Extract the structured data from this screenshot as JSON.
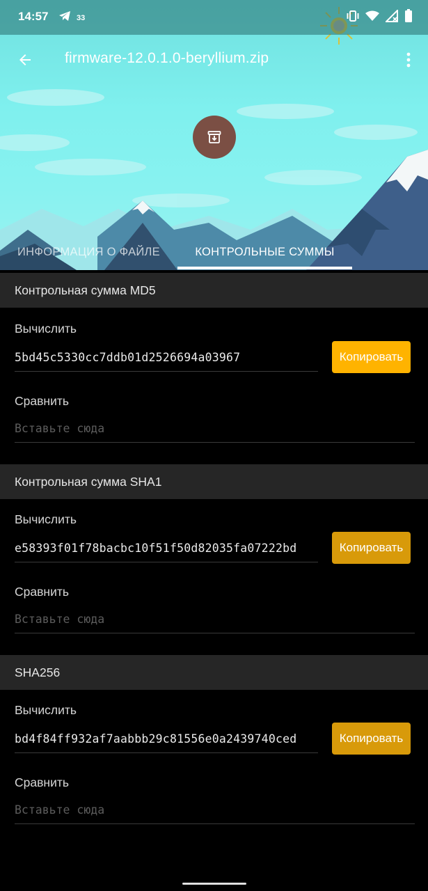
{
  "status": {
    "time": "14:57",
    "notif_count": "33",
    "icons": [
      "telegram-icon",
      "vibrate-icon",
      "wifi-icon",
      "signal-icon",
      "battery-icon"
    ]
  },
  "appbar": {
    "title": "firmware-12.0.1.0-beryllium.zip",
    "back_icon": "arrow-back-icon",
    "menu_icon": "more-vert-icon"
  },
  "file_icon": "archive-icon",
  "tabs": [
    {
      "label": "ИНФОРМАЦИЯ О ФАЙЛЕ",
      "selected": false
    },
    {
      "label": "КОНТРОЛЬНЫЕ СУММЫ",
      "selected": true
    }
  ],
  "colors": {
    "accent_button": "#ffb300",
    "accent_button_dim": "#d89a0a",
    "section_header_bg": "#262626",
    "avatar_bg": "#7b4f44"
  },
  "sections": [
    {
      "header": "Контрольная сумма MD5",
      "compute_label": "Вычислить",
      "hash": "5bd45c5330cc7ddb01d2526694a03967",
      "copy_label": "Копировать",
      "compare_label": "Сравнить",
      "compare_placeholder": "Вставьте сюда"
    },
    {
      "header": "Контрольная сумма SHA1",
      "compute_label": "Вычислить",
      "hash": "e58393f01f78bacbc10f51f50d82035fa07222bd",
      "copy_label": "Копировать",
      "compare_label": "Сравнить",
      "compare_placeholder": "Вставьте сюда"
    },
    {
      "header": "SHA256",
      "compute_label": "Вычислить",
      "hash": "bd4f84ff932af7aabbb29c81556e0a2439740ced",
      "copy_label": "Копировать",
      "compare_label": "Сравнить",
      "compare_placeholder": "Вставьте сюда"
    }
  ]
}
